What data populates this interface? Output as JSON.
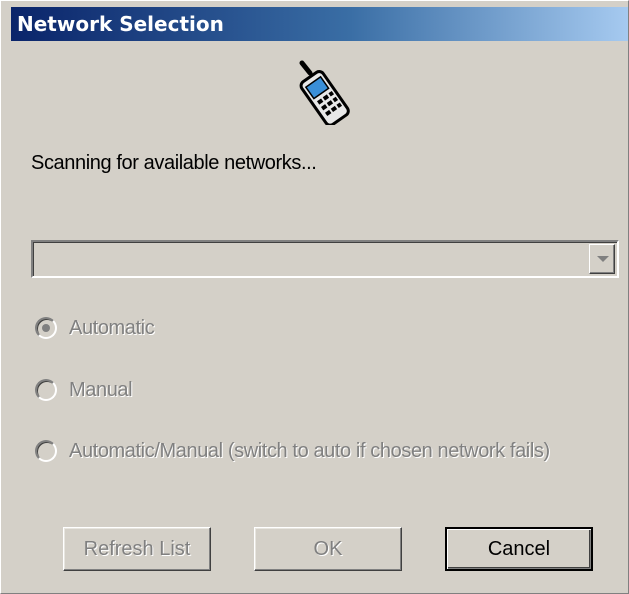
{
  "window": {
    "title": "Network Selection"
  },
  "status": {
    "text": "Scanning for available networks..."
  },
  "network_combo": {
    "value": ""
  },
  "modes": [
    {
      "label": "Automatic",
      "checked": true
    },
    {
      "label": "Manual",
      "checked": false
    },
    {
      "label": "Automatic/Manual (switch to auto if chosen network fails)",
      "checked": false
    }
  ],
  "buttons": {
    "refresh": "Refresh List",
    "ok": "OK",
    "cancel": "Cancel"
  },
  "icons": {
    "header_icon": "mobile-phone-icon"
  },
  "colors": {
    "titlebar_start": "#0a246a",
    "titlebar_end": "#a6caf0",
    "face": "#d4d0c8",
    "disabled_text": "#808080"
  }
}
